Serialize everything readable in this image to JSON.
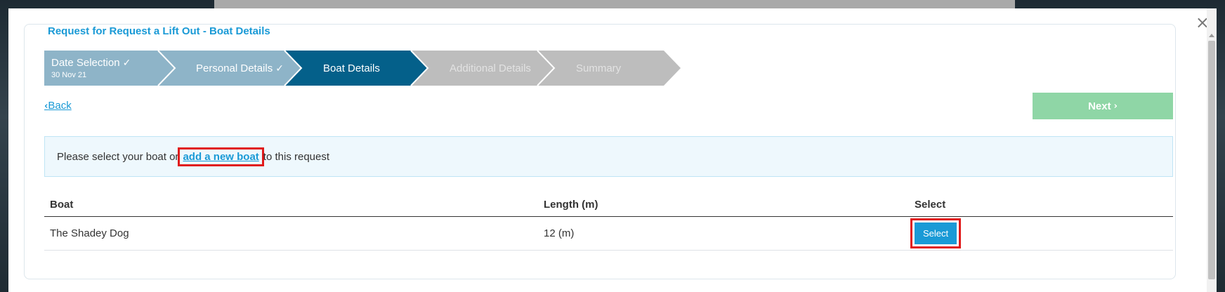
{
  "modal": {
    "close_glyph": "×",
    "title": "Request for Request a Lift Out - Boat Details"
  },
  "wizard": {
    "steps": [
      {
        "label": "Date Selection",
        "sub": "30 Nov 21",
        "state": "completed",
        "color": "#8eb4c8"
      },
      {
        "label": "Personal Details",
        "state": "completed",
        "color": "#8eb4c8"
      },
      {
        "label": "Boat Details",
        "state": "active",
        "color": "#04608a"
      },
      {
        "label": "Additional Details",
        "state": "upcoming",
        "color": "#bdbdbd"
      },
      {
        "label": "Summary",
        "state": "upcoming",
        "color": "#bdbdbd"
      }
    ],
    "check_glyph": "✓"
  },
  "nav": {
    "back_label": "Back",
    "next_label": "Next"
  },
  "info": {
    "before": "Please select your boat or",
    "link": "add a new boat",
    "after": "to this request"
  },
  "table": {
    "headers": {
      "boat": "Boat",
      "length": "Length (m)",
      "select": "Select"
    },
    "rows": [
      {
        "boat": "The Shadey Dog",
        "length": "12 (m)",
        "select_label": "Select"
      }
    ]
  },
  "colors": {
    "accent": "#1a9ad6",
    "next_disabled": "#8fd6a6",
    "highlight": "#e01b1b"
  }
}
